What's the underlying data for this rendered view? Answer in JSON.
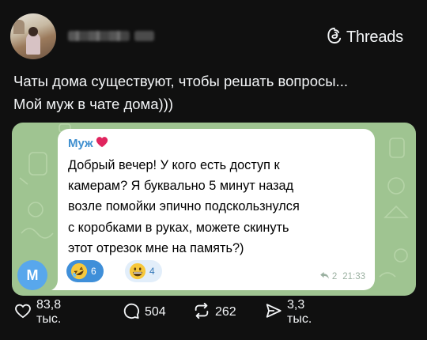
{
  "header": {
    "brand": "Threads",
    "brand_icon": "threads-logo-icon"
  },
  "post": {
    "text_lines": [
      "Чаты дома существуют, чтобы решать вопросы...",
      "Мой муж в чате дома)))"
    ]
  },
  "message": {
    "sender": "Муж",
    "sender_icon": "red-heart-icon",
    "avatar_letter": "M",
    "text_lines": [
      "Добрый вечер! У кого есть доступ к",
      "камерам? Я буквально 5 минут назад",
      "возле помойки эпично подскользнулся",
      "с коробками в руках, можете скинуть",
      "этот отрезок мне на память?)"
    ],
    "reactions": [
      {
        "emoji": "rolling-on-floor-laughing-emoji",
        "count": "6",
        "selected": true
      },
      {
        "emoji": "grinning-emoji",
        "count": "4",
        "selected": false
      }
    ],
    "reply_count": "2",
    "time": "21:33"
  },
  "actions": {
    "likes": "83,8 тыс.",
    "comments": "504",
    "reposts": "262",
    "shares": "3,3 тыс."
  },
  "colors": {
    "background": "#101010",
    "chat_background": "#9fc491",
    "bubble": "#ffffff",
    "sender": "#3f8fcf",
    "avatar": "#58a7ec",
    "reaction_selected": "#3f8fd9",
    "reaction": "#e2eefa"
  }
}
